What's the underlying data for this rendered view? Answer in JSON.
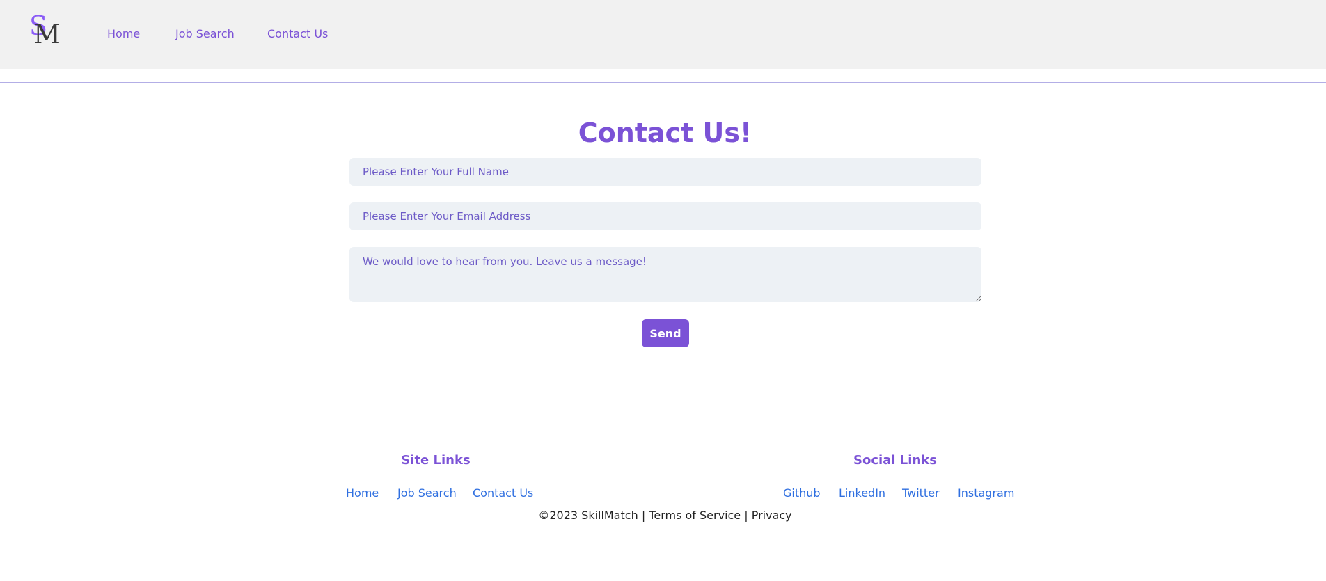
{
  "header": {
    "logo": {
      "letter_s": "S",
      "letter_m": "M"
    },
    "nav": [
      "Home",
      "Job Search",
      "Contact Us"
    ]
  },
  "contact": {
    "title": "Contact Us!",
    "name_placeholder": "Please Enter Your Full Name",
    "email_placeholder": "Please Enter Your Email Address",
    "message_placeholder": "We would love to hear from you. Leave us a message!",
    "send_label": "Send"
  },
  "footer": {
    "site_links_title": "Site Links",
    "site_links": [
      "Home",
      "Job Search",
      "Contact Us"
    ],
    "social_links_title": "Social Links",
    "social_links": [
      "Github",
      "LinkedIn",
      "Twitter",
      "Instagram"
    ],
    "copyright": "©2023 SkillMatch | Terms of Service | Privacy"
  },
  "colors": {
    "accent": "#7b52d6",
    "header_bg": "#f1f1f1",
    "input_bg": "#edf1f5",
    "link_blue": "#2f6fe0"
  }
}
